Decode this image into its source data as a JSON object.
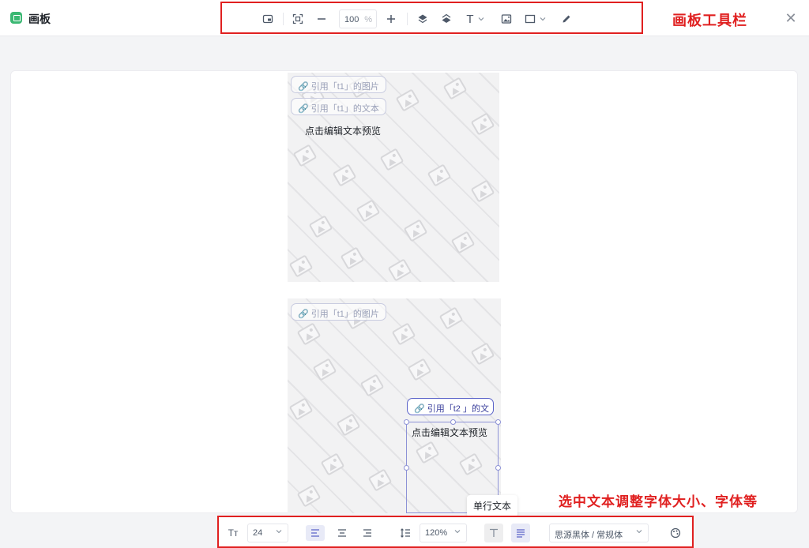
{
  "header": {
    "title": "画板",
    "close_label": "✕",
    "annotation": "画板工具栏"
  },
  "top_toolbar": {
    "zoom_value": "100",
    "zoom_unit": "%",
    "text_tool_label": "T"
  },
  "canvas": {
    "board1": {
      "ref_image_label": "🔗 引用「t1」的图片",
      "ref_text_label": "🔗 引用「t1」的文本",
      "preview_text": "点击编辑文本预览"
    },
    "board2": {
      "ref_image_label": "🔗 引用「t1」的图片",
      "ref_text_label": "🔗 引用「t2 」的文",
      "preview_text": "点击编辑文本预览"
    },
    "tooltip": "单行文本"
  },
  "bottom_toolbar": {
    "font_size_icon": "Tт",
    "font_size": "24",
    "line_height": "120%",
    "font_family": "思源黑体 / 常规体",
    "annotation": "选中文本调整字体大小、字体等"
  },
  "colors": {
    "annotation": "#e02020",
    "selection": "#8d92d6",
    "accent": "#3bb873"
  }
}
